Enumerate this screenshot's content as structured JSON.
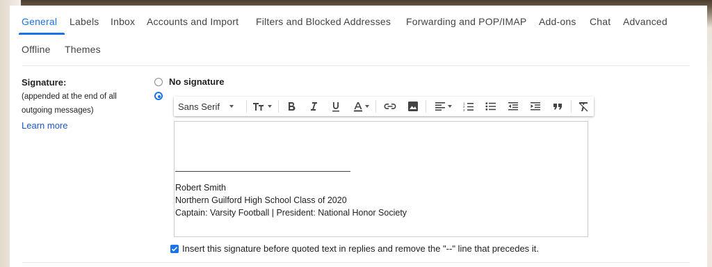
{
  "tabs": [
    {
      "label": "General",
      "active": true
    },
    {
      "label": "Labels"
    },
    {
      "label": "Inbox"
    },
    {
      "label": "Accounts and Import"
    },
    {
      "label": "Filters and Blocked Addresses"
    },
    {
      "label": "Forwarding and POP/IMAP"
    },
    {
      "label": "Add-ons"
    },
    {
      "label": "Chat"
    },
    {
      "label": "Advanced"
    },
    {
      "label": "Offline"
    },
    {
      "label": "Themes"
    }
  ],
  "signature": {
    "title": "Signature:",
    "desc_line1": "(appended at the end of all",
    "desc_line2": "outgoing messages)",
    "learn_more": "Learn more",
    "no_signature_label": "No signature",
    "selected_option": "custom"
  },
  "toolbar": {
    "font": "Sans Serif",
    "icons": [
      "font-size-icon",
      "bold-icon",
      "italic-icon",
      "underline-icon",
      "text-color-icon",
      "link-icon",
      "image-icon",
      "align-icon",
      "numbered-list-icon",
      "bulleted-list-icon",
      "indent-less-icon",
      "indent-more-icon",
      "quote-icon",
      "remove-formatting-icon"
    ]
  },
  "editor": {
    "name": "Robert Smith",
    "line2": "Northern Guilford High School Class of 2020",
    "line3": "Captain: Varsity Football | President: National Honor Society"
  },
  "insert_option": {
    "checked": true,
    "label": "Insert this signature before quoted text in replies and remove the \"--\" line that precedes it."
  },
  "colors": {
    "accent": "#1a73e8",
    "link": "#1a56c8"
  }
}
